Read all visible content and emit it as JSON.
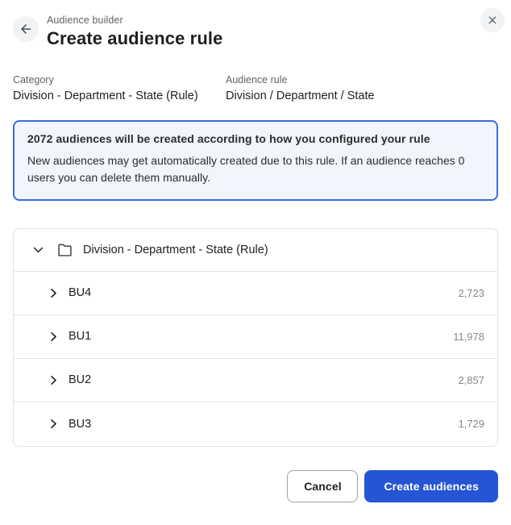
{
  "header": {
    "eyebrow": "Audience builder",
    "title": "Create audience rule"
  },
  "meta": {
    "category_label": "Category",
    "category_value": "Division - Department - State (Rule)",
    "rule_label": "Audience rule",
    "rule_value": "Division / Department / State"
  },
  "banner": {
    "title": "2072 audiences will be created according to how you configured your rule",
    "body": "New audiences may get automatically created due to this rule. If an audience reaches 0 users you can delete them manually."
  },
  "tree": {
    "root_label": "Division - Department - State (Rule)",
    "rows": [
      {
        "label": "BU4",
        "count": "2,723"
      },
      {
        "label": "BU1",
        "count": "11,978"
      },
      {
        "label": "BU2",
        "count": "2,857"
      },
      {
        "label": "BU3",
        "count": "1,729"
      }
    ]
  },
  "footer": {
    "cancel_label": "Cancel",
    "create_label": "Create audiences"
  },
  "colors": {
    "accent_blue": "#2554d4",
    "banner_border": "#3b6be0",
    "banner_bg": "#f0f5fe"
  }
}
